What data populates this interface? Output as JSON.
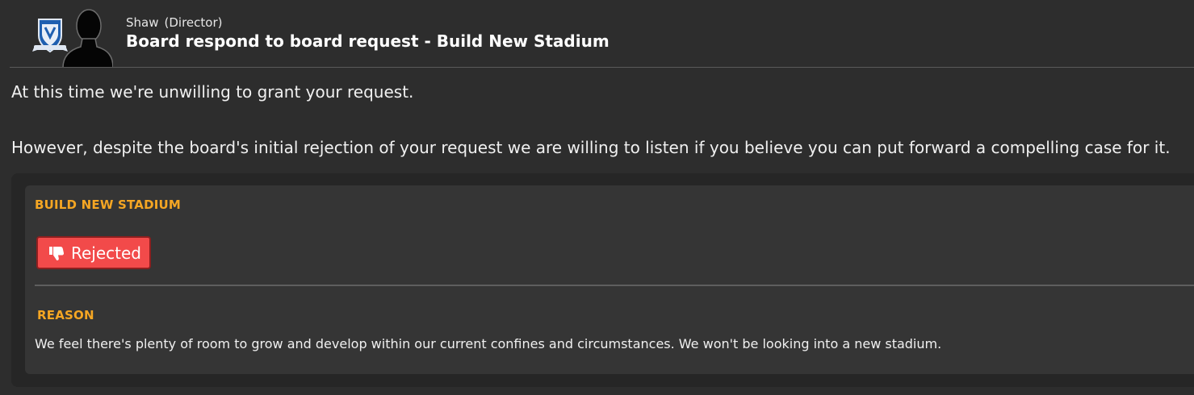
{
  "message": {
    "sender_name": "Shaw",
    "sender_role": "(Director)",
    "title": "Board respond to board request - Build New Stadium",
    "paragraph_1": "At this time we're unwilling to grant your request.",
    "paragraph_2": "However, despite the board's initial rejection of your request we are willing to listen if you believe you can put forward a compelling case for it."
  },
  "request": {
    "heading": "BUILD NEW STADIUM",
    "status_label": "Rejected",
    "status_icon": "thumbs-down-icon",
    "status_color": "#f24a4a",
    "reason_heading": "REASON",
    "reason_text": "We feel there's plenty of room to grow and develop within our current confines and circumstances. We won't be looking into a new stadium."
  },
  "colors": {
    "accent": "#f5a623",
    "background": "#2d2d2d"
  }
}
